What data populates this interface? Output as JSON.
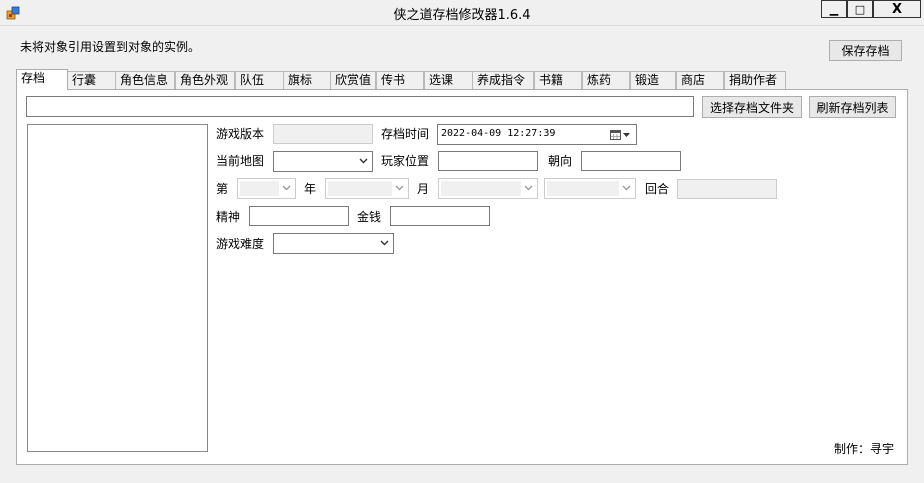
{
  "window": {
    "title": "侠之道存档修改器1.6.4",
    "minimize_glyph": "▁",
    "maximize_glyph": "□",
    "close_glyph": "X"
  },
  "status_message": "未将对象引用设置到对象的实例。",
  "save_button": "保存存档",
  "tabs": [
    {
      "label": "存档",
      "active": true
    },
    {
      "label": "行囊"
    },
    {
      "label": "角色信息"
    },
    {
      "label": "角色外观"
    },
    {
      "label": "队伍"
    },
    {
      "label": "旗标"
    },
    {
      "label": "欣赏值"
    },
    {
      "label": "传书"
    },
    {
      "label": "选课"
    },
    {
      "label": "养成指令"
    },
    {
      "label": "书籍"
    },
    {
      "label": "炼药"
    },
    {
      "label": "锻造"
    },
    {
      "label": "商店"
    },
    {
      "label": "捐助作者"
    }
  ],
  "path_field": {
    "value": ""
  },
  "choose_folder_button": "选择存档文件夹",
  "refresh_list_button": "刷新存档列表",
  "form": {
    "game_version_label": "游戏版本",
    "save_time_label": "存档时间",
    "save_time_value": "2022-04-09 12:27:39",
    "current_map_label": "当前地图",
    "player_position_label": "玩家位置",
    "facing_label": "朝向",
    "di_label": "第",
    "year_label": "年",
    "month_label": "月",
    "round_label": "回合",
    "spirit_label": "精神",
    "money_label": "金钱",
    "difficulty_label": "游戏难度"
  },
  "credit": "制作：寻宇",
  "icons": {
    "app": "app-icon",
    "calendar": "calendar-icon",
    "dropdown": "chevron-down-icon"
  }
}
